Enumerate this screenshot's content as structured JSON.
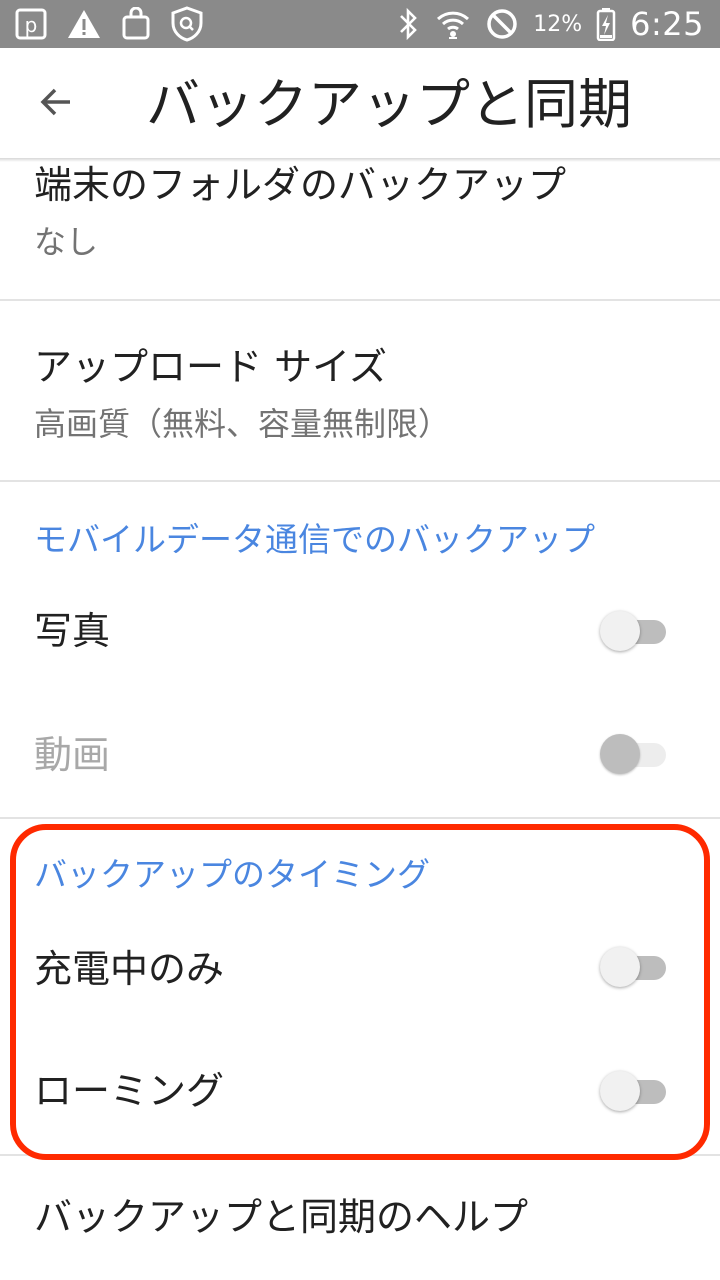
{
  "status_bar": {
    "battery_percent": "12%",
    "time": "6:25",
    "icons": [
      "p-app-icon",
      "warning-icon",
      "shopping-bag-icon",
      "shield-icon",
      "bluetooth-icon",
      "wifi-icon",
      "do-not-disturb-icon",
      "battery-charging-icon"
    ]
  },
  "app_bar": {
    "title": "バックアップと同期",
    "back_icon": "arrow-back-icon"
  },
  "items": {
    "device_folders": {
      "title": "端末のフォルダのバックアップ",
      "subtitle": "なし"
    },
    "upload_size": {
      "title": "アップロード サイズ",
      "subtitle": "高画質（無料、容量無制限）"
    },
    "mobile_data_header": "モバイルデータ通信でのバックアップ",
    "photos": {
      "title": "写真",
      "enabled": false
    },
    "videos": {
      "title": "動画",
      "enabled": false,
      "disabled": true
    },
    "timing_header": "バックアップのタイミング",
    "charging_only": {
      "title": "充電中のみ",
      "enabled": false
    },
    "roaming": {
      "title": "ローミング",
      "enabled": false
    },
    "help": {
      "title": "バックアップと同期のヘルプ"
    }
  },
  "colors": {
    "status_bar": "#8a8a8a",
    "section_header": "#4a86e0",
    "highlight": "#ff2a00",
    "primary_text": "#212121",
    "secondary_text": "#737373"
  }
}
